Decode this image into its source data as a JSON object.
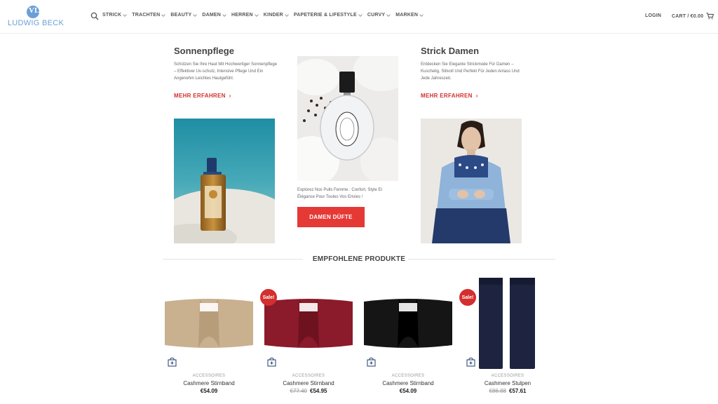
{
  "header": {
    "logo_mark": "VL",
    "logo_text": "LUDWIG BECK",
    "nav": [
      "STRICK",
      "TRACHTEN",
      "BEAUTY",
      "DAMEN",
      "HERREN",
      "KINDER",
      "PAPETERIE & LIFESTYLE",
      "CURVY",
      "MARKEN"
    ],
    "login": "LOGIN",
    "cart": "CART / €0.00"
  },
  "promos": {
    "left": {
      "title": "Sonnenpflege",
      "desc": "Schützen Sie Ihre Haut Mit Hochwertiger Sonnenpflege – Effektiver Uv-schutz, Intensive Pflege Und Ein Angenehm Leichtes Hautgefühl.",
      "link": "MEHR ERFAHREN"
    },
    "center": {
      "desc": "Explorez Nos Pulls Femme : Confort, Style Et Élégance Pour Toutes Vos Envies !",
      "button": "DAMEN DÜFTE"
    },
    "right": {
      "title": "Strick Damen",
      "desc": "Entdecken Sie Elegante Strickmode Für Damen – Kuschelig, Stilvoll Und Perfekt Für Jeden Anlass Und Jede Jahreszeit.",
      "link": "MEHR ERFAHREN"
    }
  },
  "featured": {
    "title": "EMPFOHLENE PRODUKTE",
    "products": [
      {
        "category": "ACCESSOIRES",
        "name": "Cashmere Stirnband",
        "old_price": "",
        "price": "€54.09",
        "sale": "",
        "color": "#c9b08f"
      },
      {
        "category": "ACCESSOIRES",
        "name": "Cashmere Stirnband",
        "old_price": "€77.40",
        "price": "€54.95",
        "sale": "Sale!",
        "color": "#8b1a2b"
      },
      {
        "category": "ACCESSOIRES",
        "name": "Cashmere Stirnband",
        "old_price": "",
        "price": "€54.09",
        "sale": "",
        "color": "#151515"
      },
      {
        "category": "ACCESSOIRES",
        "name": "Cashmere Stulpen",
        "old_price": "€86.88",
        "price": "€57.61",
        "sale": "Sale!",
        "color": "#1e2440"
      }
    ]
  },
  "colors": {
    "accent": "#d32f2f",
    "logo": "#6b9fd8"
  }
}
